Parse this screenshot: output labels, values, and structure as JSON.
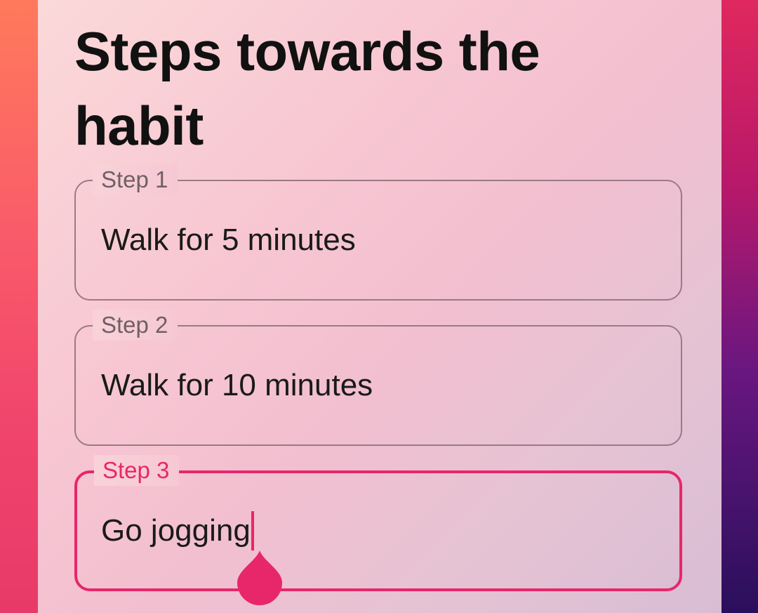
{
  "screen": {
    "title": "Steps towards the habit"
  },
  "steps": [
    {
      "label": "Step 1",
      "value": "Walk for 5 minutes",
      "focused": false
    },
    {
      "label": "Step 2",
      "value": "Walk for 10 minutes",
      "focused": false
    },
    {
      "label": "Step 3",
      "value": "Go jogging",
      "focused": true
    }
  ],
  "colors": {
    "accent": "#e8266a",
    "outline": "#9a7a84",
    "label": "#6f5f66",
    "text": "#1a1a1a"
  }
}
